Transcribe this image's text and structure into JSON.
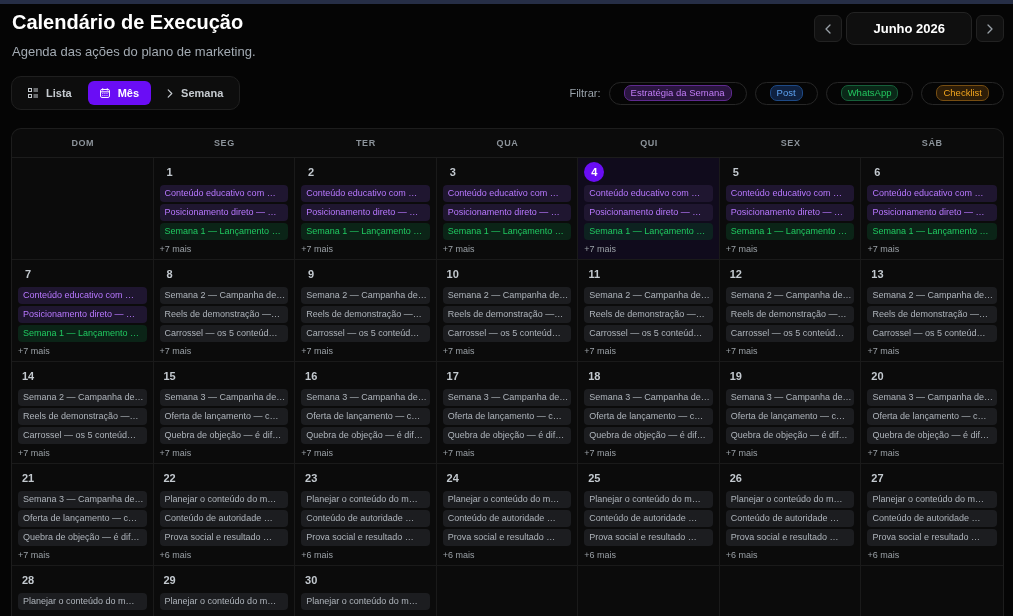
{
  "header": {
    "title": "Calendário de Execução",
    "subtitle": "Agenda das ações do plano de marketing."
  },
  "month_nav": {
    "label": "Junho 2026"
  },
  "view_tabs": [
    {
      "label": "Lista",
      "kind": "list",
      "selected": false
    },
    {
      "label": "Mês",
      "kind": "month",
      "selected": true
    },
    {
      "label": "Semana",
      "kind": "week",
      "selected": false
    }
  ],
  "filters": {
    "label": "Filtrar:",
    "items": [
      {
        "label": "Estratégia da Semana",
        "kind": "strategy"
      },
      {
        "label": "Post",
        "kind": "post"
      },
      {
        "label": "WhatsApp",
        "kind": "whatsapp"
      },
      {
        "label": "Checklist",
        "kind": "checklist"
      }
    ]
  },
  "calendar": {
    "weekdays": [
      "DOM",
      "SEG",
      "TER",
      "QUA",
      "QUI",
      "SEX",
      "SÁB"
    ],
    "weeks": [
      {
        "days": [
          {
            "kind": "empty"
          },
          {
            "kind": "day",
            "date": "1",
            "today": false,
            "events": [
              {
                "title": "Conteúdo educativo com …",
                "kind": "strategy"
              },
              {
                "title": "Posicionamento direto — …",
                "kind": "strategy"
              },
              {
                "title": "Semana 1 — Lançamento …",
                "kind": "whatsapp"
              }
            ],
            "more": "+7 mais"
          },
          {
            "kind": "day",
            "date": "2",
            "today": false,
            "events": [
              {
                "title": "Conteúdo educativo com …",
                "kind": "strategy"
              },
              {
                "title": "Posicionamento direto — …",
                "kind": "strategy"
              },
              {
                "title": "Semana 1 — Lançamento …",
                "kind": "whatsapp"
              }
            ],
            "more": "+7 mais"
          },
          {
            "kind": "day",
            "date": "3",
            "today": false,
            "events": [
              {
                "title": "Conteúdo educativo com …",
                "kind": "strategy"
              },
              {
                "title": "Posicionamento direto — …",
                "kind": "strategy"
              },
              {
                "title": "Semana 1 — Lançamento …",
                "kind": "whatsapp"
              }
            ],
            "more": "+7 mais"
          },
          {
            "kind": "day",
            "date": "4",
            "today": true,
            "events": [
              {
                "title": "Conteúdo educativo com …",
                "kind": "strategy"
              },
              {
                "title": "Posicionamento direto — …",
                "kind": "strategy"
              },
              {
                "title": "Semana 1 — Lançamento …",
                "kind": "whatsapp"
              }
            ],
            "more": "+7 mais"
          },
          {
            "kind": "day",
            "date": "5",
            "today": false,
            "events": [
              {
                "title": "Conteúdo educativo com …",
                "kind": "strategy"
              },
              {
                "title": "Posicionamento direto — …",
                "kind": "strategy"
              },
              {
                "title": "Semana 1 — Lançamento …",
                "kind": "whatsapp"
              }
            ],
            "more": "+7 mais"
          },
          {
            "kind": "day",
            "date": "6",
            "today": false,
            "events": [
              {
                "title": "Conteúdo educativo com …",
                "kind": "strategy"
              },
              {
                "title": "Posicionamento direto — …",
                "kind": "strategy"
              },
              {
                "title": "Semana 1 — Lançamento …",
                "kind": "whatsapp"
              }
            ],
            "more": "+7 mais"
          }
        ]
      },
      {
        "days": [
          {
            "kind": "day",
            "date": "7",
            "today": false,
            "events": [
              {
                "title": "Conteúdo educativo com …",
                "kind": "strategy"
              },
              {
                "title": "Posicionamento direto — …",
                "kind": "strategy"
              },
              {
                "title": "Semana 1 — Lançamento …",
                "kind": "whatsapp"
              }
            ],
            "more": "+7 mais"
          },
          {
            "kind": "day",
            "date": "8",
            "today": false,
            "events": [
              {
                "title": "Semana 2 — Campanha de…",
                "kind": "plain"
              },
              {
                "title": "Reels de demonstração —…",
                "kind": "plain"
              },
              {
                "title": "Carrossel — os 5 conteúd…",
                "kind": "plain"
              }
            ],
            "more": "+7 mais"
          },
          {
            "kind": "day",
            "date": "9",
            "today": false,
            "events": [
              {
                "title": "Semana 2 — Campanha de…",
                "kind": "plain"
              },
              {
                "title": "Reels de demonstração —…",
                "kind": "plain"
              },
              {
                "title": "Carrossel — os 5 conteúd…",
                "kind": "plain"
              }
            ],
            "more": "+7 mais"
          },
          {
            "kind": "day",
            "date": "10",
            "today": false,
            "events": [
              {
                "title": "Semana 2 — Campanha de…",
                "kind": "plain"
              },
              {
                "title": "Reels de demonstração —…",
                "kind": "plain"
              },
              {
                "title": "Carrossel — os 5 conteúd…",
                "kind": "plain"
              }
            ],
            "more": "+7 mais"
          },
          {
            "kind": "day",
            "date": "11",
            "today": false,
            "events": [
              {
                "title": "Semana 2 — Campanha de…",
                "kind": "plain"
              },
              {
                "title": "Reels de demonstração —…",
                "kind": "plain"
              },
              {
                "title": "Carrossel — os 5 conteúd…",
                "kind": "plain"
              }
            ],
            "more": "+7 mais"
          },
          {
            "kind": "day",
            "date": "12",
            "today": false,
            "events": [
              {
                "title": "Semana 2 — Campanha de…",
                "kind": "plain"
              },
              {
                "title": "Reels de demonstração —…",
                "kind": "plain"
              },
              {
                "title": "Carrossel — os 5 conteúd…",
                "kind": "plain"
              }
            ],
            "more": "+7 mais"
          },
          {
            "kind": "day",
            "date": "13",
            "today": false,
            "events": [
              {
                "title": "Semana 2 — Campanha de…",
                "kind": "plain"
              },
              {
                "title": "Reels de demonstração —…",
                "kind": "plain"
              },
              {
                "title": "Carrossel — os 5 conteúd…",
                "kind": "plain"
              }
            ],
            "more": "+7 mais"
          }
        ]
      },
      {
        "days": [
          {
            "kind": "day",
            "date": "14",
            "today": false,
            "events": [
              {
                "title": "Semana 2 — Campanha de…",
                "kind": "plain"
              },
              {
                "title": "Reels de demonstração —…",
                "kind": "plain"
              },
              {
                "title": "Carrossel — os 5 conteúd…",
                "kind": "plain"
              }
            ],
            "more": "+7 mais"
          },
          {
            "kind": "day",
            "date": "15",
            "today": false,
            "events": [
              {
                "title": "Semana 3 — Campanha de…",
                "kind": "plain"
              },
              {
                "title": "Oferta de lançamento — c…",
                "kind": "plain"
              },
              {
                "title": "Quebra de objeção — é dif…",
                "kind": "plain"
              }
            ],
            "more": "+7 mais"
          },
          {
            "kind": "day",
            "date": "16",
            "today": false,
            "events": [
              {
                "title": "Semana 3 — Campanha de…",
                "kind": "plain"
              },
              {
                "title": "Oferta de lançamento — c…",
                "kind": "plain"
              },
              {
                "title": "Quebra de objeção — é dif…",
                "kind": "plain"
              }
            ],
            "more": "+7 mais"
          },
          {
            "kind": "day",
            "date": "17",
            "today": false,
            "events": [
              {
                "title": "Semana 3 — Campanha de…",
                "kind": "plain"
              },
              {
                "title": "Oferta de lançamento — c…",
                "kind": "plain"
              },
              {
                "title": "Quebra de objeção — é dif…",
                "kind": "plain"
              }
            ],
            "more": "+7 mais"
          },
          {
            "kind": "day",
            "date": "18",
            "today": false,
            "events": [
              {
                "title": "Semana 3 — Campanha de…",
                "kind": "plain"
              },
              {
                "title": "Oferta de lançamento — c…",
                "kind": "plain"
              },
              {
                "title": "Quebra de objeção — é dif…",
                "kind": "plain"
              }
            ],
            "more": "+7 mais"
          },
          {
            "kind": "day",
            "date": "19",
            "today": false,
            "events": [
              {
                "title": "Semana 3 — Campanha de…",
                "kind": "plain"
              },
              {
                "title": "Oferta de lançamento — c…",
                "kind": "plain"
              },
              {
                "title": "Quebra de objeção — é dif…",
                "kind": "plain"
              }
            ],
            "more": "+7 mais"
          },
          {
            "kind": "day",
            "date": "20",
            "today": false,
            "events": [
              {
                "title": "Semana 3 — Campanha de…",
                "kind": "plain"
              },
              {
                "title": "Oferta de lançamento — c…",
                "kind": "plain"
              },
              {
                "title": "Quebra de objeção — é dif…",
                "kind": "plain"
              }
            ],
            "more": "+7 mais"
          }
        ]
      },
      {
        "days": [
          {
            "kind": "day",
            "date": "21",
            "today": false,
            "events": [
              {
                "title": "Semana 3 — Campanha de…",
                "kind": "plain"
              },
              {
                "title": "Oferta de lançamento — c…",
                "kind": "plain"
              },
              {
                "title": "Quebra de objeção — é dif…",
                "kind": "plain"
              }
            ],
            "more": "+7 mais"
          },
          {
            "kind": "day",
            "date": "22",
            "today": false,
            "events": [
              {
                "title": "Planejar o conteúdo do m…",
                "kind": "plain"
              },
              {
                "title": "Conteúdo de autoridade …",
                "kind": "plain"
              },
              {
                "title": "Prova social e resultado …",
                "kind": "plain"
              }
            ],
            "more": "+6 mais"
          },
          {
            "kind": "day",
            "date": "23",
            "today": false,
            "events": [
              {
                "title": "Planejar o conteúdo do m…",
                "kind": "plain"
              },
              {
                "title": "Conteúdo de autoridade …",
                "kind": "plain"
              },
              {
                "title": "Prova social e resultado …",
                "kind": "plain"
              }
            ],
            "more": "+6 mais"
          },
          {
            "kind": "day",
            "date": "24",
            "today": false,
            "events": [
              {
                "title": "Planejar o conteúdo do m…",
                "kind": "plain"
              },
              {
                "title": "Conteúdo de autoridade …",
                "kind": "plain"
              },
              {
                "title": "Prova social e resultado …",
                "kind": "plain"
              }
            ],
            "more": "+6 mais"
          },
          {
            "kind": "day",
            "date": "25",
            "today": false,
            "events": [
              {
                "title": "Planejar o conteúdo do m…",
                "kind": "plain"
              },
              {
                "title": "Conteúdo de autoridade …",
                "kind": "plain"
              },
              {
                "title": "Prova social e resultado …",
                "kind": "plain"
              }
            ],
            "more": "+6 mais"
          },
          {
            "kind": "day",
            "date": "26",
            "today": false,
            "events": [
              {
                "title": "Planejar o conteúdo do m…",
                "kind": "plain"
              },
              {
                "title": "Conteúdo de autoridade …",
                "kind": "plain"
              },
              {
                "title": "Prova social e resultado …",
                "kind": "plain"
              }
            ],
            "more": "+6 mais"
          },
          {
            "kind": "day",
            "date": "27",
            "today": false,
            "events": [
              {
                "title": "Planejar o conteúdo do m…",
                "kind": "plain"
              },
              {
                "title": "Conteúdo de autoridade …",
                "kind": "plain"
              },
              {
                "title": "Prova social e resultado …",
                "kind": "plain"
              }
            ],
            "more": "+6 mais"
          }
        ]
      },
      {
        "days": [
          {
            "kind": "day",
            "date": "28",
            "today": false,
            "events": [
              {
                "title": "Planejar o conteúdo do m…",
                "kind": "plain"
              }
            ]
          },
          {
            "kind": "day",
            "date": "29",
            "today": false,
            "events": [
              {
                "title": "Planejar o conteúdo do m…",
                "kind": "plain"
              }
            ]
          },
          {
            "kind": "day",
            "date": "30",
            "today": false,
            "events": [
              {
                "title": "Planejar o conteúdo do m…",
                "kind": "plain"
              }
            ]
          },
          {
            "kind": "empty"
          },
          {
            "kind": "empty"
          },
          {
            "kind": "empty"
          },
          {
            "kind": "empty"
          }
        ]
      }
    ]
  }
}
